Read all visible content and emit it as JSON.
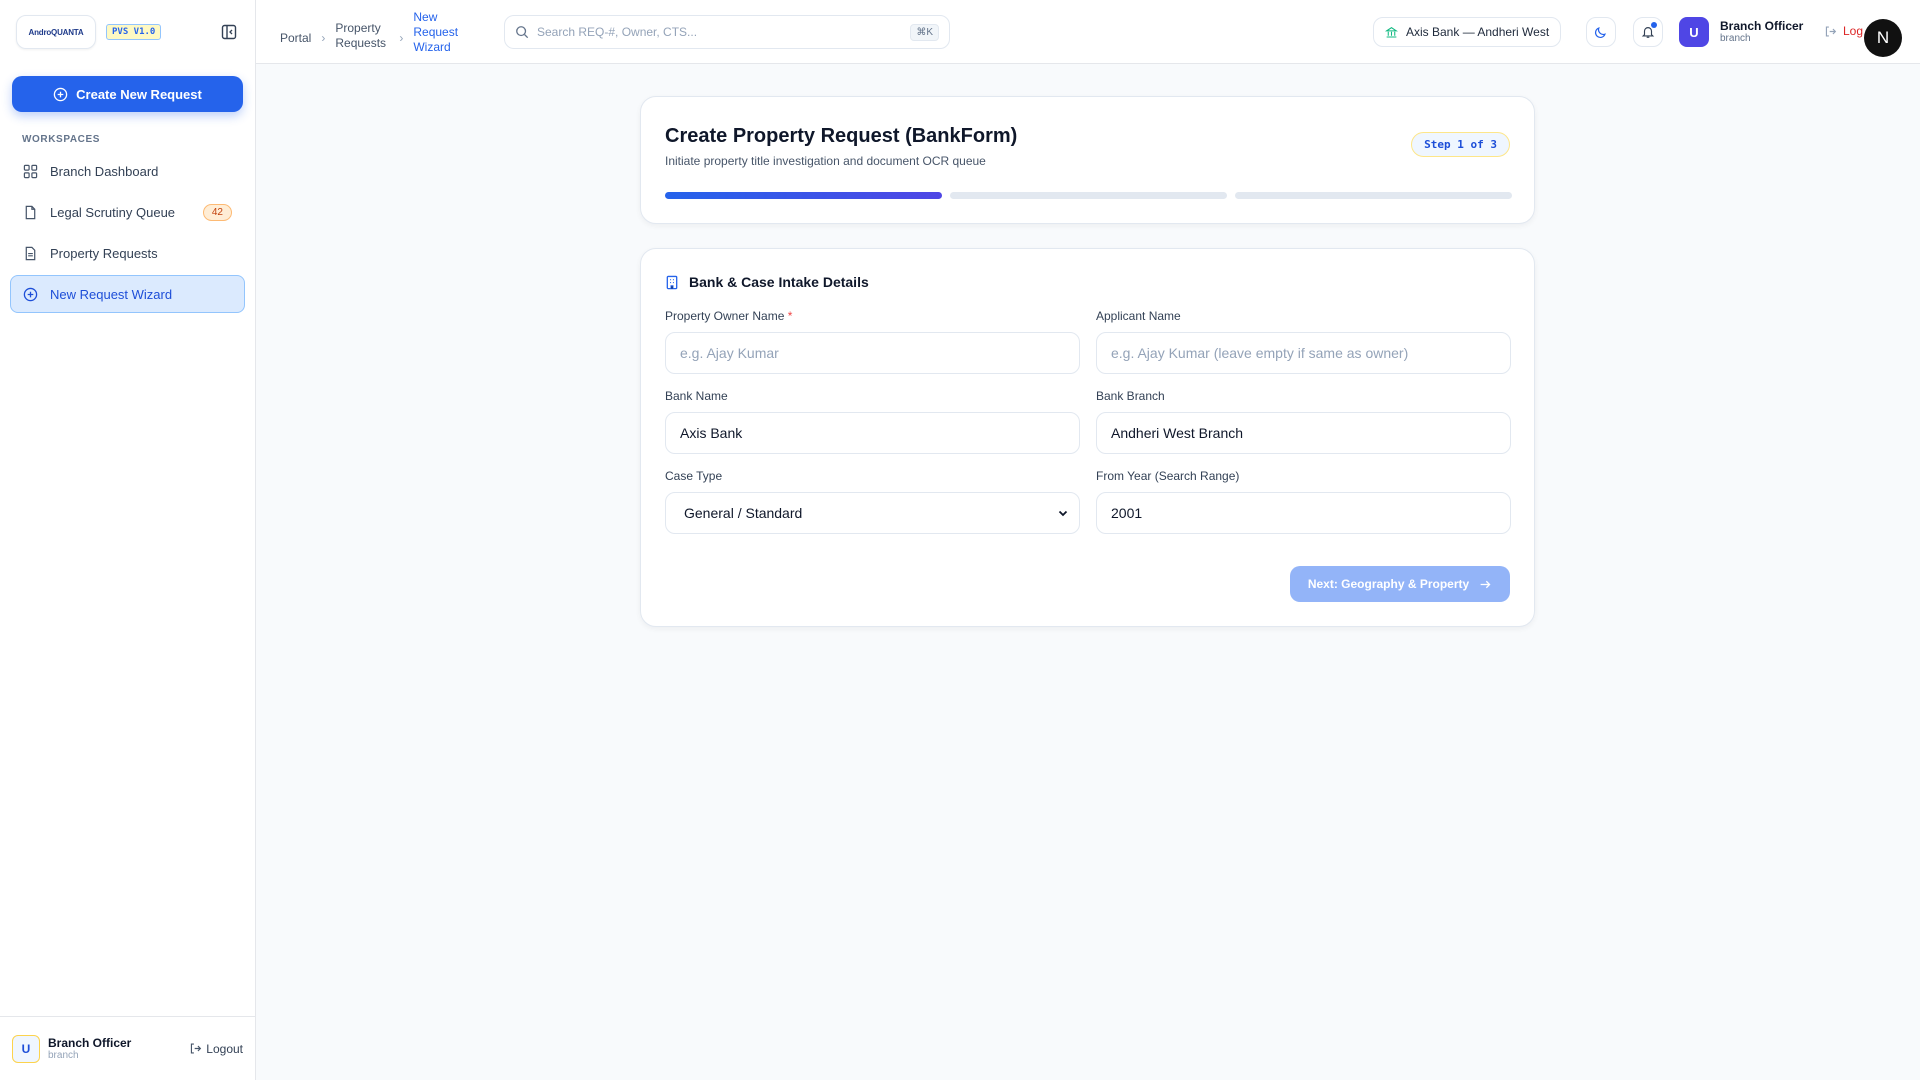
{
  "sidebar": {
    "logo_text": "AndroQUANTA",
    "version": "PVS V1.0",
    "create_label": "Create New Request",
    "section_label": "WORKSPACES",
    "items": [
      {
        "label": "Branch Dashboard",
        "icon": "grid-icon"
      },
      {
        "label": "Legal Scrutiny Queue",
        "icon": "file-icon",
        "count": "42"
      },
      {
        "label": "Property Requests",
        "icon": "document-icon"
      },
      {
        "label": "New Request Wizard",
        "icon": "plus-circle-icon",
        "active": true
      }
    ],
    "user": {
      "initial": "U",
      "name": "Branch Officer",
      "role": "branch"
    },
    "logout_label": "Logout"
  },
  "header": {
    "breadcrumb": [
      "Portal",
      "Property Requests",
      "New Request Wizard"
    ],
    "search_placeholder": "Search REQ-#, Owner, CTS...",
    "search_shortcut": "⌘K",
    "bank_chip": "Axis Bank — Andheri West",
    "user": {
      "initial": "U",
      "name": "Branch Officer",
      "role": "branch"
    },
    "logout_label": "Logout",
    "floating_badge": "N"
  },
  "wizard": {
    "title": "Create Property Request (BankForm)",
    "subtitle": "Initiate property title investigation and document OCR queue",
    "step_label": "Step 1 of 3",
    "current_step": 1,
    "total_steps": 3
  },
  "form": {
    "section_title": "Bank & Case Intake Details",
    "owner_label": "Property Owner Name",
    "owner_required": "*",
    "owner_placeholder": "e.g. Ajay Kumar",
    "applicant_label": "Applicant Name",
    "applicant_placeholder": "e.g. Ajay Kumar (leave empty if same as owner)",
    "bank_name_label": "Bank Name",
    "bank_name_value": "Axis Bank",
    "bank_branch_label": "Bank Branch",
    "bank_branch_value": "Andheri West Branch",
    "case_type_label": "Case Type",
    "case_type_value": "General / Standard",
    "from_year_label": "From Year (Search Range)",
    "from_year_value": "2001",
    "next_label": "Next: Geography & Property"
  },
  "colors": {
    "primary": "#2563eb",
    "active_nav_bg": "#dbeafe",
    "disabled_button": "#93b4f8"
  }
}
